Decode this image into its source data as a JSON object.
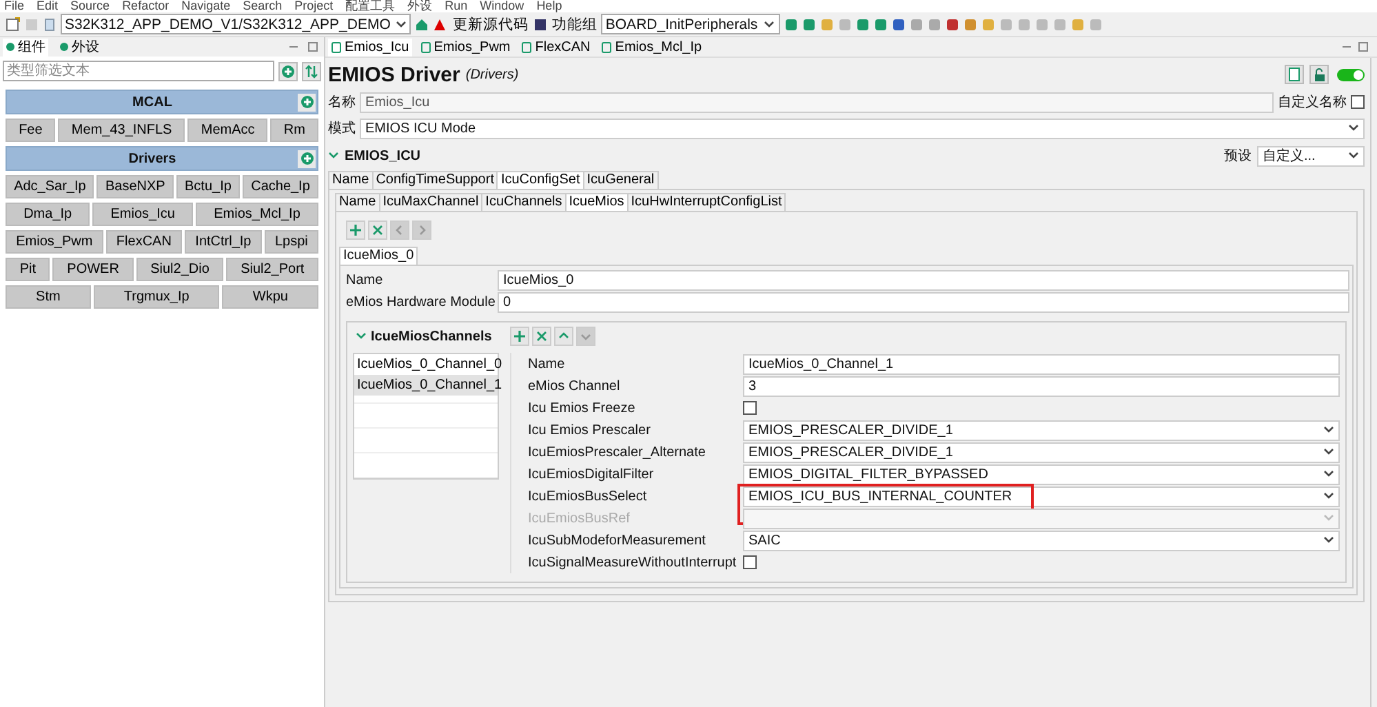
{
  "menu_bar": [
    "File",
    "Edit",
    "Source",
    "Refactor",
    "Navigate",
    "Search",
    "Project",
    "配置工具",
    "外设",
    "Run",
    "Window",
    "Help"
  ],
  "toolbar": {
    "project": "S32K312_APP_DEMO_V1/S32K312_APP_DEMO",
    "update_button": "更新源代码",
    "function_group_label": "功能组",
    "function_group": "BOARD_InitPeripherals"
  },
  "left_panel": {
    "tabs": [
      {
        "label": "组件",
        "selected": true
      },
      {
        "label": "外设",
        "selected": false
      }
    ],
    "filter": {
      "placeholder": "类型筛选文本"
    },
    "groups": [
      {
        "title": "MCAL",
        "rows": [
          [
            "Fee",
            "Mem_43_INFLS",
            "MemAcc",
            "Rm"
          ]
        ]
      },
      {
        "title": "Drivers",
        "rows": [
          [
            "Adc_Sar_Ip",
            "BaseNXP",
            "Bctu_Ip",
            "Cache_Ip"
          ],
          [
            "Dma_Ip",
            "Emios_Icu",
            "Emios_Mcl_Ip"
          ],
          [
            "Emios_Pwm",
            "FlexCAN",
            "IntCtrl_Ip",
            "Lpspi"
          ],
          [
            "Pit",
            "POWER",
            "Siul2_Dio",
            "Siul2_Port"
          ],
          [
            "Stm",
            "Trgmux_Ip",
            "Wkpu"
          ]
        ]
      }
    ]
  },
  "editor_tabs": [
    {
      "label": "Emios_Icu",
      "selected": true
    },
    {
      "label": "Emios_Pwm",
      "selected": false
    },
    {
      "label": "FlexCAN",
      "selected": false
    },
    {
      "label": "Emios_Mcl_Ip",
      "selected": false
    }
  ],
  "header": {
    "title": "EMIOS Driver",
    "category": "(Drivers)",
    "enabled": true
  },
  "name_row": {
    "label": "名称",
    "value": "Emios_Icu",
    "custom_label": "自定义名称",
    "custom": false
  },
  "mode": {
    "label": "模式",
    "value": "EMIOS ICU Mode"
  },
  "section": {
    "title": "EMIOS_ICU",
    "expanded": true,
    "preset_label": "预设",
    "preset": "自定义..."
  },
  "tabs_1": [
    {
      "label": "Name",
      "selected": false
    },
    {
      "label": "ConfigTimeSupport",
      "selected": false
    },
    {
      "label": "IcuConfigSet",
      "selected": true
    },
    {
      "label": "IcuGeneral",
      "selected": false
    }
  ],
  "tabs_2": [
    {
      "label": "Name",
      "selected": false
    },
    {
      "label": "IcuMaxChannel",
      "selected": false
    },
    {
      "label": "IcuChannels",
      "selected": false
    },
    {
      "label": "IcueMios",
      "selected": true
    },
    {
      "label": "IcuHwInterruptConfigList",
      "selected": false
    }
  ],
  "list_buttons": [
    {
      "kind": "add",
      "disabled": false
    },
    {
      "kind": "remove",
      "disabled": false
    },
    {
      "kind": "left",
      "disabled": true
    },
    {
      "kind": "right",
      "disabled": true
    }
  ],
  "instance_tab": "IcueMios_0",
  "instance_fields": [
    {
      "label": "Name",
      "value": "IcueMios_0"
    },
    {
      "label": "eMios Hardware Module",
      "value": "0"
    }
  ],
  "channel_group": {
    "title": "IcueMiosChannels",
    "expanded": true,
    "buttons": [
      {
        "kind": "add",
        "disabled": false
      },
      {
        "kind": "remove",
        "disabled": false
      },
      {
        "kind": "up",
        "disabled": false
      },
      {
        "kind": "down",
        "disabled": true
      }
    ],
    "items": [
      {
        "label": "IcueMios_0_Channel_0",
        "selected": false
      },
      {
        "label": "IcueMios_0_Channel_1",
        "selected": true
      }
    ],
    "properties": [
      {
        "kind": "text",
        "label": "Name",
        "value": "IcueMios_0_Channel_1",
        "disabled": false,
        "highlighted": false
      },
      {
        "kind": "text",
        "label": "eMios Channel",
        "value": "3",
        "disabled": false,
        "highlighted": false
      },
      {
        "kind": "checkbox",
        "label": "Icu Emios Freeze",
        "checked": false,
        "disabled": false,
        "highlighted": false
      },
      {
        "kind": "dropdown",
        "label": "Icu Emios Prescaler",
        "value": "EMIOS_PRESCALER_DIVIDE_1",
        "disabled": false,
        "highlighted": false
      },
      {
        "kind": "dropdown",
        "label": "IcuEmiosPrescaler_Alternate",
        "value": "EMIOS_PRESCALER_DIVIDE_1",
        "disabled": false,
        "highlighted": false
      },
      {
        "kind": "dropdown",
        "label": "IcuEmiosDigitalFilter",
        "value": "EMIOS_DIGITAL_FILTER_BYPASSED",
        "disabled": false,
        "highlighted": false
      },
      {
        "kind": "dropdown",
        "label": "IcuEmiosBusSelect",
        "value": "EMIOS_ICU_BUS_INTERNAL_COUNTER",
        "disabled": false,
        "highlighted": true
      },
      {
        "kind": "dropdown",
        "label": "IcuEmiosBusRef",
        "disabled": true,
        "highlighted": false
      },
      {
        "kind": "dropdown",
        "label": "IcuSubModeforMeasurement",
        "value": "SAIC",
        "disabled": false,
        "highlighted": false
      },
      {
        "kind": "checkbox",
        "label": "IcuSignalMeasureWithoutInterrupt",
        "checked": false,
        "disabled": false,
        "highlighted": false
      }
    ]
  }
}
